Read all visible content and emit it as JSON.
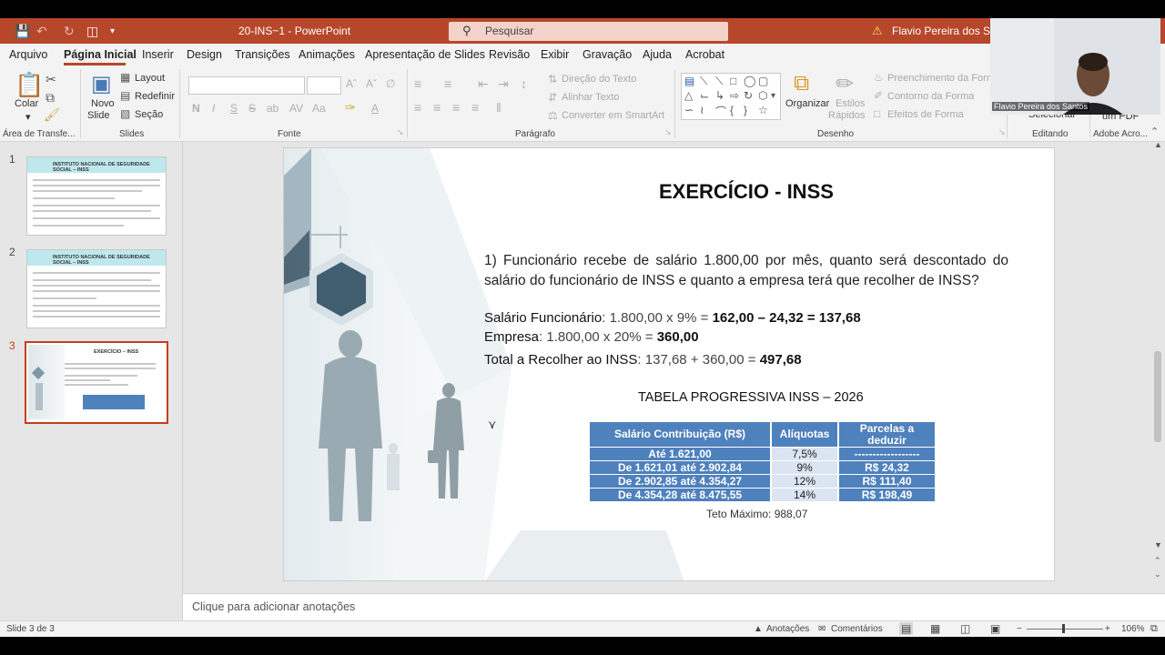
{
  "app": {
    "doc_title": "20-INS~1  -  PowerPoint",
    "search_placeholder": "Pesquisar",
    "user_name": "Flavio Pereira dos Santos"
  },
  "menu": [
    "Arquivo",
    "Página Inicial",
    "Inserir",
    "Design",
    "Transições",
    "Animações",
    "Apresentação de Slides",
    "Revisão",
    "Exibir",
    "Gravação",
    "Ajuda",
    "Acrobat"
  ],
  "ribbon": {
    "clipboard": {
      "paste": "Colar",
      "group": "Área de Transfe..."
    },
    "slides": {
      "new_slide_1": "Novo",
      "new_slide_2": "Slide",
      "layout": "Layout",
      "reset": "Redefinir",
      "section": "Seção",
      "group": "Slides"
    },
    "font": {
      "group": "Fonte"
    },
    "paragraph": {
      "text_direction": "Direção do Texto",
      "align_text": "Alinhar Texto",
      "smartart": "Converter em SmartArt",
      "group": "Parágrafo"
    },
    "drawing": {
      "arrange": "Organizar",
      "styles_1": "Estilos",
      "styles_2": "Rápidos",
      "fill": "Preenchimento da Forma",
      "outline": "Contorno da Forma",
      "effects": "Efeitos de Forma",
      "group": "Desenho"
    },
    "editing": {
      "select": "Selecionar",
      "group": "Editando"
    },
    "adobe": {
      "pdf": "um PDF",
      "group": "Adobe Acro..."
    }
  },
  "thumbnails": [
    {
      "num": "1",
      "header": "INSTITUTO NACIONAL DE SEGURIDADE SOCIAL – INSS"
    },
    {
      "num": "2",
      "header": "INSTITUTO NACIONAL DE SEGURIDADE SOCIAL – INSS"
    },
    {
      "num": "3",
      "header": "EXERCÍCIO – INSS"
    }
  ],
  "slide": {
    "title": "EXERCÍCIO - INSS",
    "question": "1) Funcionário recebe de salário 1.800,00 por mês, quanto será descontado do salário do funcionário de INSS e quanto a empresa terá que recolher de INSS?",
    "line1_label": "Salário Funcionário",
    "line1_calc": ": 1.800,00 x 9% = ",
    "line1_result": "162,00 – 24,32 = 137,68",
    "line2_label": "Empresa",
    "line2_calc": ": 1.800,00 x 20% = ",
    "line2_result": "360,00",
    "line3_label": "Total a Recolher ao INSS",
    "line3_calc": ": 137,68 + 360,00 = ",
    "line3_result": "497,68",
    "table_title": "TABELA PROGRESSIVA INSS – 2026",
    "table_headers": [
      "Salário Contribuição (R$)",
      "Alíquotas",
      "Parcelas a deduzir"
    ],
    "table_rows": [
      [
        "Até 1.621,00",
        "7,5%",
        "------------------"
      ],
      [
        "De 1.621,01 até 2.902,84",
        "9%",
        "R$ 24,32"
      ],
      [
        "De 2.902,85 até 4.354,27",
        "12%",
        "R$ 111,40"
      ],
      [
        "De 4.354,28 até 8.475,55",
        "14%",
        "R$ 198,49"
      ]
    ],
    "teto": "Teto Máximo: 988,07"
  },
  "notes_placeholder": "Clique para adicionar anotações",
  "status": {
    "slide_info": "Slide 3 de 3",
    "notes": "Anotações",
    "comments": "Comentários",
    "zoom": "106%"
  },
  "colors": {
    "accent": "#b7472a",
    "table_dark": "#4f81bd",
    "table_light": "#dbe4f1"
  }
}
